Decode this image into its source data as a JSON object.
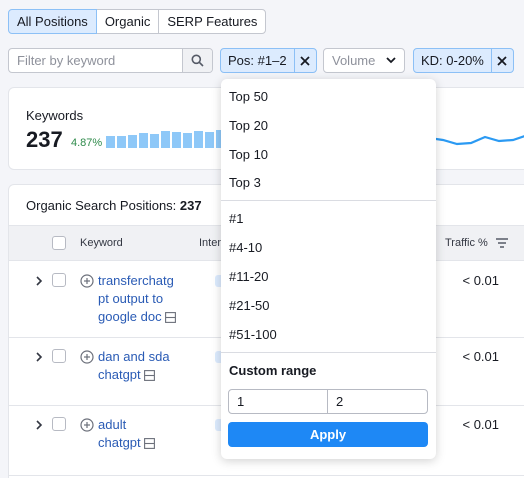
{
  "tabs": [
    "All Positions",
    "Organic",
    "SERP Features"
  ],
  "filters": {
    "search_placeholder": "Filter by keyword",
    "position_chip": "Pos: #1–2",
    "volume_label": "Volume",
    "kd_chip": "KD: 0-20%"
  },
  "keywords_card": {
    "title": "Keywords",
    "count": "237",
    "delta": "4.87%"
  },
  "table": {
    "title_prefix": "Organic Search Positions:",
    "title_count": "237",
    "headers": {
      "keyword": "Keyword",
      "intent": "Inten",
      "traffic": "Traffic %"
    },
    "rows": [
      {
        "keyword_lines": [
          "transferchatg",
          "pt output to",
          "google doc"
        ],
        "traffic": "< 0.01"
      },
      {
        "keyword_lines": [
          "dan and sda",
          "chatgpt"
        ],
        "traffic": "< 0.01"
      },
      {
        "keyword_lines": [
          "adult",
          "chatgpt"
        ],
        "traffic": "< 0.01"
      }
    ]
  },
  "dropdown": {
    "top_options": [
      "Top 50",
      "Top 20",
      "Top 10",
      "Top 3"
    ],
    "position_options": [
      "#1",
      "#4-10",
      "#11-20",
      "#21-50",
      "#51-100"
    ],
    "custom_title": "Custom range",
    "range_from": "1",
    "range_to": "2",
    "apply_label": "Apply"
  },
  "colors": {
    "accent": "#1e88f5",
    "chip_bg": "#dcebfe",
    "link": "#2a5bb5",
    "positive": "#2e8a4a",
    "bar": "#8ec8f8"
  }
}
